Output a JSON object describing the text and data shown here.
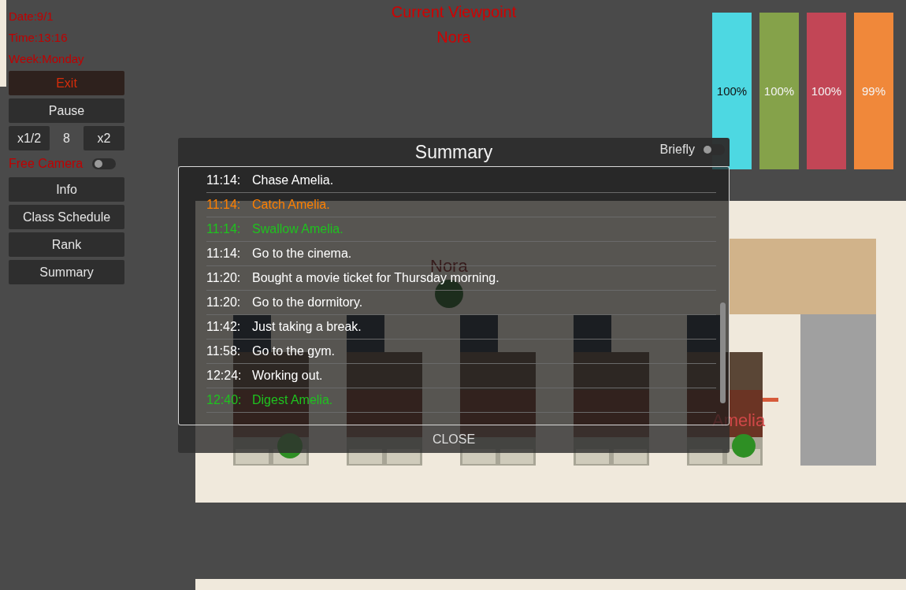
{
  "hud": {
    "date": "Date:9/1",
    "time": "Time:13:16",
    "week": "Week:Monday"
  },
  "controls": {
    "exit": "Exit",
    "pause": "Pause",
    "slower": "x1/2",
    "speed": "8",
    "faster": "x2",
    "free_camera": {
      "label": "Free Camera",
      "on": false
    },
    "menu": [
      "Info",
      "Class Schedule",
      "Rank",
      "Summary"
    ]
  },
  "viewpoint": {
    "title": "Current Viewpoint",
    "name": "Nora"
  },
  "meters": [
    {
      "label": "100%",
      "color": "#4dd8e2"
    },
    {
      "label": "100%",
      "color": "#85a24a"
    },
    {
      "label": "100%",
      "color": "#c24656"
    },
    {
      "label": "99%",
      "color": "#f0883a"
    }
  ],
  "map": {
    "characters": [
      {
        "name": "Nora"
      },
      {
        "name": "Amelia"
      }
    ]
  },
  "summary": {
    "title": "Summary",
    "briefly": {
      "label": "Briefly",
      "on": false
    },
    "entries": [
      {
        "time": "11:14:",
        "text": "Chase Amelia.",
        "color": "#ffffff"
      },
      {
        "time": "11:14:",
        "text": "Catch Amelia.",
        "color": "#ff8000"
      },
      {
        "time": "11:14:",
        "text": "Swallow Amelia.",
        "color": "#1fc21f"
      },
      {
        "time": "11:14:",
        "text": "Go to the cinema.",
        "color": "#ffffff"
      },
      {
        "time": "11:20:",
        "text": "Bought a movie ticket for Thursday morning.",
        "color": "#ffffff"
      },
      {
        "time": "11:20:",
        "text": "Go to the dormitory.",
        "color": "#ffffff"
      },
      {
        "time": "11:42:",
        "text": "Just taking a break.",
        "color": "#ffffff"
      },
      {
        "time": "11:58:",
        "text": "Go to the gym.",
        "color": "#ffffff"
      },
      {
        "time": "12:24:",
        "text": "Working out.",
        "color": "#ffffff"
      },
      {
        "time": "12:40:",
        "text": "Digest Amelia.",
        "color": "#1fc21f"
      }
    ],
    "close": "CLOSE"
  }
}
